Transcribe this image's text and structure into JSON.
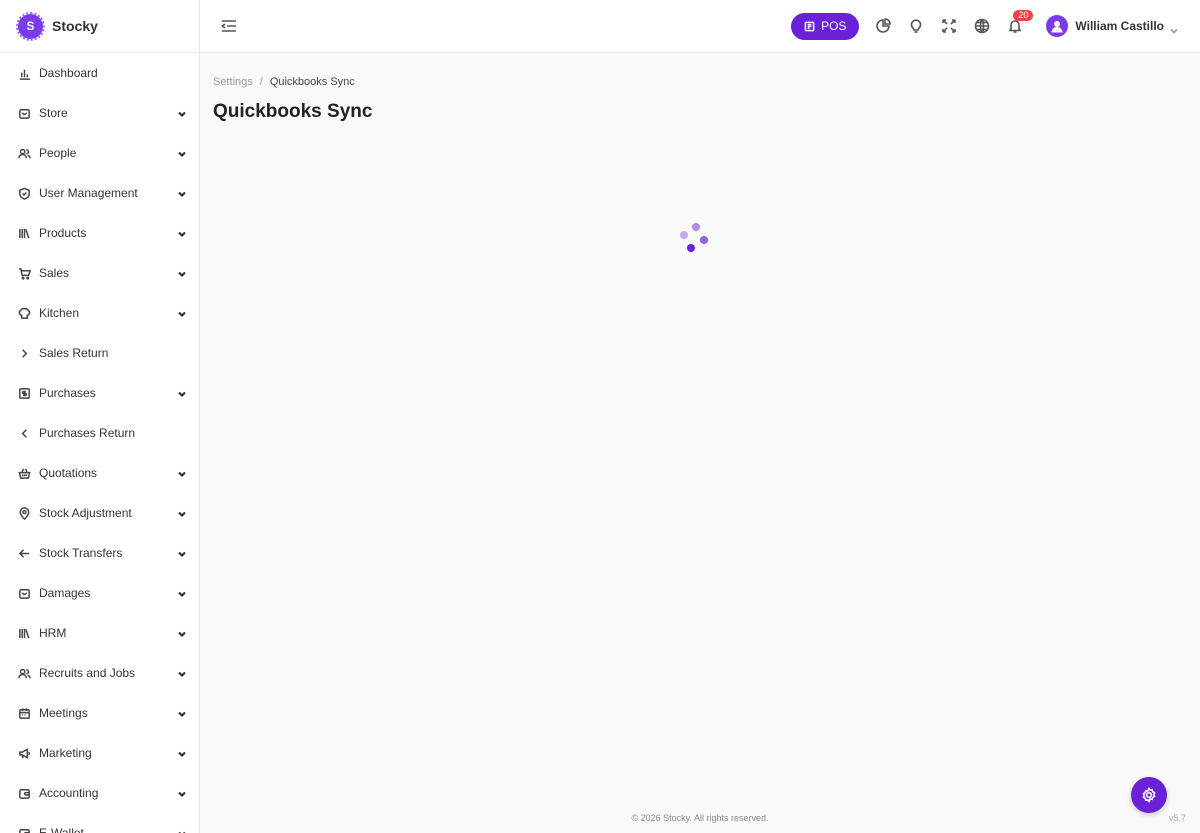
{
  "brand": {
    "name": "Stocky",
    "logo_letter": "S"
  },
  "sidebar": {
    "items": [
      {
        "label": "Dashboard",
        "icon": "bar-chart-icon",
        "chevron": "none"
      },
      {
        "label": "Store",
        "icon": "bag-icon",
        "chevron": "down"
      },
      {
        "label": "People",
        "icon": "users-icon",
        "chevron": "down"
      },
      {
        "label": "User Management",
        "icon": "shield-icon",
        "chevron": "down"
      },
      {
        "label": "Products",
        "icon": "library-icon",
        "chevron": "down"
      },
      {
        "label": "Sales",
        "icon": "cart-icon",
        "chevron": "down"
      },
      {
        "label": "Kitchen",
        "icon": "chef-hat-icon",
        "chevron": "down"
      },
      {
        "label": "Sales Return",
        "icon": "chevron-right-icon",
        "chevron": "none"
      },
      {
        "label": "Purchases",
        "icon": "receipt-icon",
        "chevron": "down"
      },
      {
        "label": "Purchases Return",
        "icon": "chevron-left-icon",
        "chevron": "none"
      },
      {
        "label": "Quotations",
        "icon": "basket-icon",
        "chevron": "down"
      },
      {
        "label": "Stock Adjustment",
        "icon": "map-pin-icon",
        "chevron": "down"
      },
      {
        "label": "Stock Transfers",
        "icon": "arrow-left-icon",
        "chevron": "down"
      },
      {
        "label": "Damages",
        "icon": "bag-icon",
        "chevron": "down"
      },
      {
        "label": "HRM",
        "icon": "library-icon",
        "chevron": "down"
      },
      {
        "label": "Recruits and Jobs",
        "icon": "users-icon",
        "chevron": "down"
      },
      {
        "label": "Meetings",
        "icon": "calendar-icon",
        "chevron": "down"
      },
      {
        "label": "Marketing",
        "icon": "megaphone-icon",
        "chevron": "down"
      },
      {
        "label": "Accounting",
        "icon": "wallet-icon",
        "chevron": "down"
      },
      {
        "label": "E-Wallet",
        "icon": "wallet-icon",
        "chevron": "down"
      }
    ]
  },
  "topbar": {
    "pos_label": "POS",
    "notification_count": "20",
    "user_name": "William Castillo",
    "icons": [
      "menu-toggle-icon",
      "pie-chart-icon",
      "lightbulb-icon",
      "fullscreen-icon",
      "globe-icon",
      "bell-icon"
    ]
  },
  "breadcrumb": {
    "parent": "Settings",
    "separator": "/",
    "current": "Quickbooks Sync"
  },
  "page": {
    "title": "Quickbooks Sync"
  },
  "footer": {
    "copyright": "© 2026 Stocky. All rights reserved.",
    "version": "v5.7"
  },
  "colors": {
    "accent": "#6b21d8",
    "accent_light": "#a57ae8",
    "badge": "#ef4444"
  }
}
